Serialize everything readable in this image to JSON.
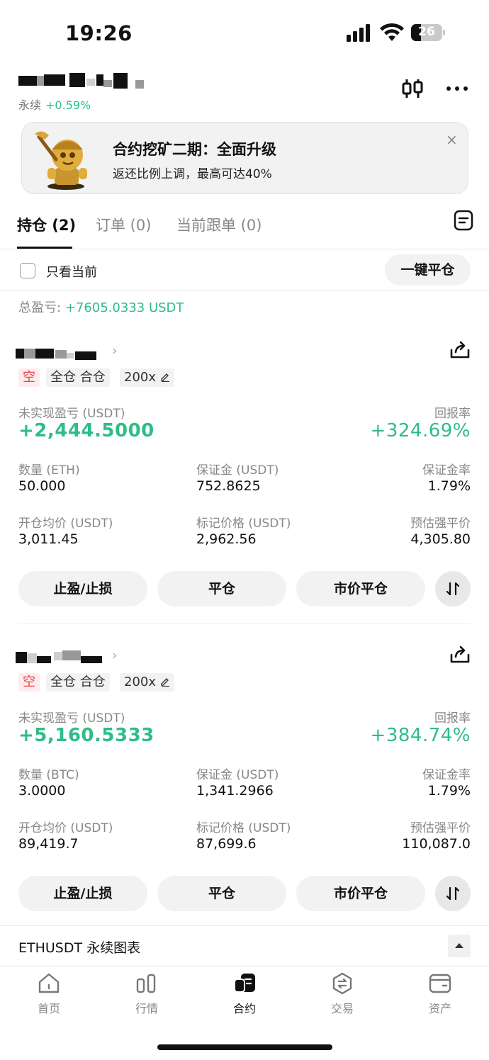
{
  "status_bar": {
    "time": "19:26",
    "battery": "26"
  },
  "header": {
    "subtitle_prefix": "永续",
    "change": "+0.59%"
  },
  "banner": {
    "title": "合约挖矿二期：全面升级",
    "subtitle": "返还比例上调，最高可达40%",
    "close": "×"
  },
  "tabs": [
    {
      "label": "持仓 (2)",
      "active": true
    },
    {
      "label": "订单 (0)",
      "active": false
    },
    {
      "label": "当前跟单 (0)",
      "active": false
    }
  ],
  "filter": {
    "checkbox_label": "只看当前",
    "close_all_label": "一键平仓"
  },
  "total_pnl": {
    "label": "总盈亏:",
    "value": "+7605.0333 USDT"
  },
  "positions": [
    {
      "side_tag": "空",
      "mode_tag": "全仓 合仓",
      "leverage": "200x",
      "unrealized_label": "未实现盈亏 (USDT)",
      "unrealized_value": "+2,444.5000",
      "roe_label": "回报率",
      "roe_value": "+324.69%",
      "qty_label": "数量 (ETH)",
      "qty_value": "50.000",
      "margin_label": "保证金 (USDT)",
      "margin_value": "752.8625",
      "margin_ratio_label": "保证金率",
      "margin_ratio_value": "1.79%",
      "entry_label": "开仓均价 (USDT)",
      "entry_value": "3,011.45",
      "mark_label": "标记价格 (USDT)",
      "mark_value": "2,962.56",
      "liq_label": "预估强平价",
      "liq_value": "4,305.80",
      "btn_tpsl": "止盈/止损",
      "btn_close": "平仓",
      "btn_market_close": "市价平仓"
    },
    {
      "side_tag": "空",
      "mode_tag": "全仓 合仓",
      "leverage": "200x",
      "unrealized_label": "未实现盈亏 (USDT)",
      "unrealized_value": "+5,160.5333",
      "roe_label": "回报率",
      "roe_value": "+384.74%",
      "qty_label": "数量 (BTC)",
      "qty_value": "3.0000",
      "margin_label": "保证金 (USDT)",
      "margin_value": "1,341.2966",
      "margin_ratio_label": "保证金率",
      "margin_ratio_value": "1.79%",
      "entry_label": "开仓均价 (USDT)",
      "entry_value": "89,419.7",
      "mark_label": "标记价格 (USDT)",
      "mark_value": "87,699.6",
      "liq_label": "预估强平价",
      "liq_value": "110,087.0",
      "btn_tpsl": "止盈/止损",
      "btn_close": "平仓",
      "btn_market_close": "市价平仓"
    }
  ],
  "chart_bar": {
    "title": "ETHUSDT 永续图表"
  },
  "bottom_nav": [
    {
      "label": "首页",
      "icon": "home-icon",
      "active": false
    },
    {
      "label": "行情",
      "icon": "market-icon",
      "active": false
    },
    {
      "label": "合约",
      "icon": "futures-icon",
      "active": true
    },
    {
      "label": "交易",
      "icon": "trade-icon",
      "active": false
    },
    {
      "label": "资产",
      "icon": "wallet-icon",
      "active": false
    }
  ],
  "colors": {
    "profit": "#2ebd85",
    "short": "#e24b4b",
    "text": "#111111",
    "muted": "#888888"
  }
}
